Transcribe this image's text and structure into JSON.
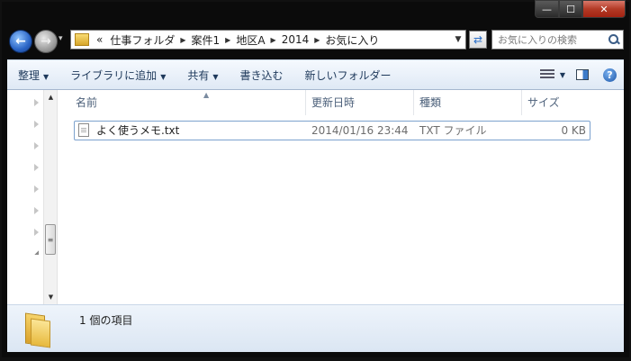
{
  "window": {
    "caption_buttons": {
      "minimize": "—",
      "maximize": "☐",
      "close": "✕"
    }
  },
  "nav": {
    "back_glyph": "←",
    "forward_glyph": "→",
    "history_glyph": "▾",
    "overflow": "«",
    "breadcrumbs": [
      "仕事フォルダ",
      "案件1",
      "地区A",
      "2014",
      "お気に入り"
    ],
    "refresh_glyph": "⇄",
    "search_placeholder": "お気に入りの検索"
  },
  "toolbar": {
    "organize": "整理",
    "add_to_library": "ライブラリに追加",
    "share": "共有",
    "burn": "書き込む",
    "new_folder": "新しいフォルダー",
    "help": "?"
  },
  "columns": {
    "name": "名前",
    "date_modified": "更新日時",
    "type": "種類",
    "size": "サイズ"
  },
  "files": [
    {
      "name": "よく使うメモ.txt",
      "date_modified": "2014/01/16 23:44",
      "type": "TXT ファイル",
      "size": "0 KB"
    }
  ],
  "details": {
    "item_count": "1 個の項目"
  },
  "icons": {
    "folder": "folder-icon",
    "text_file": "text-file-icon",
    "search": "search-icon",
    "help": "help-icon"
  }
}
